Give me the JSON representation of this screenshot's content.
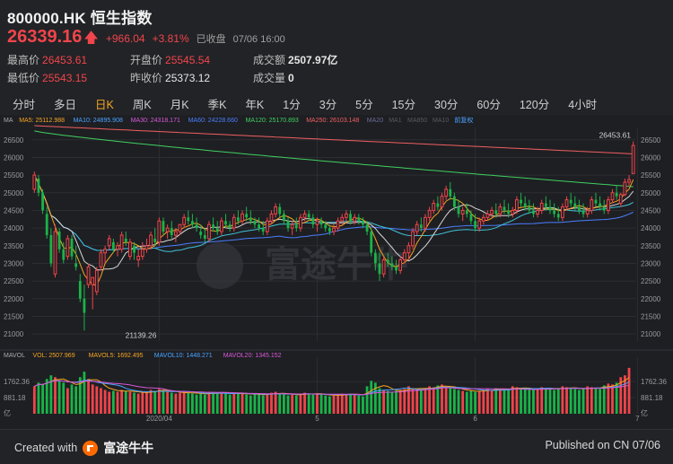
{
  "header": {
    "title": "800000.HK 恒生指数",
    "price": "26339.16",
    "change": "+966.04",
    "change_pct": "+3.81%",
    "status": "已收盘",
    "datetime": "07/06 16:00"
  },
  "stats": [
    {
      "label": "最高价",
      "value": "26453.61",
      "tone": "up"
    },
    {
      "label": "开盘价",
      "value": "25545.54",
      "tone": "up"
    },
    {
      "label": "成交额",
      "value": "2507.97亿",
      "tone": "neutral"
    },
    {
      "label": "最低价",
      "value": "25543.15",
      "tone": "up"
    },
    {
      "label": "昨收价",
      "value": "25373.12",
      "tone": "neutral"
    },
    {
      "label": "成交量",
      "value": "0",
      "tone": "neutral"
    }
  ],
  "tabs": [
    "分时",
    "多日",
    "日K",
    "周K",
    "月K",
    "季K",
    "年K",
    "1分",
    "3分",
    "5分",
    "15分",
    "30分",
    "60分",
    "120分",
    "4小时"
  ],
  "active_tab": "日K",
  "ma_legend": [
    {
      "label": "MA",
      "color": "#aaaaaa"
    },
    {
      "label": "MA5: 25112.988",
      "color": "#f5a623"
    },
    {
      "label": "MA10: 24895.908",
      "color": "#4aa3ff"
    },
    {
      "label": "MA30: 24318.171",
      "color": "#d858d8"
    },
    {
      "label": "MA60: 24228.660",
      "color": "#4a7fff"
    },
    {
      "label": "MA120: 25170.893",
      "color": "#40d060"
    },
    {
      "label": "MA250: 26103.148",
      "color": "#f06060"
    },
    {
      "label": "MA20",
      "color": "#6b6b9a"
    },
    {
      "label": "MA1",
      "color": "#5a5a5a"
    },
    {
      "label": "MA850",
      "color": "#5a5a5a"
    },
    {
      "label": "MA10",
      "color": "#5a5a5a"
    },
    {
      "label": "前复权",
      "color": "#4aa3ff"
    }
  ],
  "vol_legend": [
    {
      "label": "MAVOL",
      "color": "#aaaaaa"
    },
    {
      "label": "VOL: 2507.969",
      "color": "#f5a623"
    },
    {
      "label": "MAVOL5: 1692.495",
      "color": "#f5a623"
    },
    {
      "label": "MAVOL10: 1448.271",
      "color": "#4aa3ff"
    },
    {
      "label": "MAVOL20: 1345.152",
      "color": "#d858d8"
    }
  ],
  "watermark": "富途牛牛",
  "footer": {
    "created_with": "Created with",
    "brand": "富途牛牛",
    "published": "Published on CN 07/06"
  },
  "colors": {
    "up": "#f0454a",
    "down": "#19b548",
    "accent": "#f5a623",
    "background": "#222327"
  },
  "chart_data": {
    "type": "candlestick",
    "y_axis": {
      "ticks": [
        21000,
        21500,
        22000,
        22500,
        23000,
        23500,
        24000,
        24500,
        25000,
        25500,
        26000,
        26500
      ],
      "ylim": [
        20800,
        26850
      ]
    },
    "x_labels": [
      {
        "index": 30,
        "label": "2020/04"
      },
      {
        "index": 68,
        "label": "5"
      },
      {
        "index": 106,
        "label": "6"
      },
      {
        "index": 145,
        "label": "7"
      }
    ],
    "annotations": [
      {
        "label": "26453.61",
        "index": 147,
        "value": 26453.61
      },
      {
        "label": "21139.26",
        "index": 21,
        "value": 21139.26
      }
    ],
    "volume_axis": {
      "ticks": [
        "1762.36",
        "881.18",
        "亿"
      ],
      "ymax": 2600
    },
    "candles": [
      {
        "o": 25100,
        "h": 25600,
        "l": 25000,
        "c": 25500
      },
      {
        "o": 25400,
        "h": 25500,
        "l": 24900,
        "c": 25000
      },
      {
        "o": 25000,
        "h": 25100,
        "l": 24400,
        "c": 24500
      },
      {
        "o": 24400,
        "h": 24600,
        "l": 23700,
        "c": 23800
      },
      {
        "o": 23800,
        "h": 24000,
        "l": 22900,
        "c": 23000
      },
      {
        "o": 22700,
        "h": 24100,
        "l": 22600,
        "c": 23900
      },
      {
        "o": 23900,
        "h": 24000,
        "l": 23300,
        "c": 23400
      },
      {
        "o": 23400,
        "h": 23600,
        "l": 23000,
        "c": 23100
      },
      {
        "o": 23200,
        "h": 23800,
        "l": 23100,
        "c": 23700
      },
      {
        "o": 23700,
        "h": 23800,
        "l": 23100,
        "c": 23200
      },
      {
        "o": 23000,
        "h": 23500,
        "l": 22800,
        "c": 22900
      },
      {
        "o": 22500,
        "h": 22700,
        "l": 21900,
        "c": 22000
      },
      {
        "o": 22000,
        "h": 22400,
        "l": 21100,
        "c": 21600
      },
      {
        "o": 22400,
        "h": 23000,
        "l": 22300,
        "c": 22900
      },
      {
        "o": 22400,
        "h": 22500,
        "l": 21700,
        "c": 22600
      },
      {
        "o": 22200,
        "h": 22900,
        "l": 22100,
        "c": 22800
      },
      {
        "o": 22900,
        "h": 23400,
        "l": 22800,
        "c": 23300
      },
      {
        "o": 23300,
        "h": 23500,
        "l": 23000,
        "c": 23400
      },
      {
        "o": 23500,
        "h": 23800,
        "l": 23400,
        "c": 23700
      },
      {
        "o": 23600,
        "h": 23700,
        "l": 23300,
        "c": 23400
      },
      {
        "o": 23400,
        "h": 23600,
        "l": 23200,
        "c": 23500
      },
      {
        "o": 23400,
        "h": 23900,
        "l": 23300,
        "c": 23800
      },
      {
        "o": 23700,
        "h": 23900,
        "l": 23500,
        "c": 23600
      },
      {
        "o": 23200,
        "h": 23700,
        "l": 23100,
        "c": 23600
      },
      {
        "o": 23500,
        "h": 23600,
        "l": 23100,
        "c": 23300
      },
      {
        "o": 23100,
        "h": 23400,
        "l": 22900,
        "c": 23200
      },
      {
        "o": 23200,
        "h": 23600,
        "l": 23100,
        "c": 23400
      },
      {
        "o": 23400,
        "h": 23700,
        "l": 23300,
        "c": 23500
      },
      {
        "o": 23500,
        "h": 23900,
        "l": 23400,
        "c": 23800
      },
      {
        "o": 23700,
        "h": 24000,
        "l": 23500,
        "c": 23600
      },
      {
        "o": 23600,
        "h": 24300,
        "l": 23500,
        "c": 24200
      },
      {
        "o": 24200,
        "h": 24300,
        "l": 23800,
        "c": 23900
      },
      {
        "o": 23900,
        "h": 24100,
        "l": 23700,
        "c": 24000
      },
      {
        "o": 24000,
        "h": 24200,
        "l": 23700,
        "c": 23800
      },
      {
        "o": 23800,
        "h": 24000,
        "l": 23600,
        "c": 23900
      },
      {
        "o": 23900,
        "h": 24100,
        "l": 23800,
        "c": 24100
      },
      {
        "o": 24100,
        "h": 24400,
        "l": 24000,
        "c": 24300
      },
      {
        "o": 24300,
        "h": 24500,
        "l": 24100,
        "c": 24200
      },
      {
        "o": 24200,
        "h": 24400,
        "l": 24000,
        "c": 24100
      },
      {
        "o": 24100,
        "h": 24300,
        "l": 23900,
        "c": 24000
      },
      {
        "o": 23900,
        "h": 24100,
        "l": 23700,
        "c": 23800
      },
      {
        "o": 23800,
        "h": 24000,
        "l": 23600,
        "c": 23700
      },
      {
        "o": 23700,
        "h": 24200,
        "l": 23600,
        "c": 24100
      },
      {
        "o": 24100,
        "h": 24300,
        "l": 23900,
        "c": 24000
      },
      {
        "o": 24000,
        "h": 24200,
        "l": 23800,
        "c": 23900
      },
      {
        "o": 23900,
        "h": 24300,
        "l": 23800,
        "c": 24200
      },
      {
        "o": 24200,
        "h": 24400,
        "l": 24000,
        "c": 24100
      },
      {
        "o": 24100,
        "h": 24200,
        "l": 23900,
        "c": 24000
      },
      {
        "o": 24000,
        "h": 24400,
        "l": 23900,
        "c": 24300
      },
      {
        "o": 24300,
        "h": 24500,
        "l": 24100,
        "c": 24200
      },
      {
        "o": 24200,
        "h": 24500,
        "l": 24100,
        "c": 24400
      },
      {
        "o": 24400,
        "h": 24600,
        "l": 24200,
        "c": 24300
      },
      {
        "o": 24300,
        "h": 24500,
        "l": 24100,
        "c": 24200
      },
      {
        "o": 24200,
        "h": 24300,
        "l": 24000,
        "c": 24100
      },
      {
        "o": 24100,
        "h": 24300,
        "l": 23900,
        "c": 24000
      },
      {
        "o": 24000,
        "h": 24200,
        "l": 23800,
        "c": 23900
      },
      {
        "o": 23900,
        "h": 24300,
        "l": 23800,
        "c": 24200
      },
      {
        "o": 24200,
        "h": 24500,
        "l": 24100,
        "c": 24400
      },
      {
        "o": 24400,
        "h": 24700,
        "l": 24300,
        "c": 24600
      },
      {
        "o": 24600,
        "h": 24700,
        "l": 24300,
        "c": 24400
      },
      {
        "o": 24400,
        "h": 24500,
        "l": 24100,
        "c": 24200
      },
      {
        "o": 24200,
        "h": 24300,
        "l": 23900,
        "c": 24000
      },
      {
        "o": 24000,
        "h": 24200,
        "l": 23800,
        "c": 24100
      },
      {
        "o": 24100,
        "h": 24300,
        "l": 23900,
        "c": 24000
      },
      {
        "o": 24000,
        "h": 24400,
        "l": 23900,
        "c": 24300
      },
      {
        "o": 24300,
        "h": 24500,
        "l": 24200,
        "c": 24400
      },
      {
        "o": 24400,
        "h": 24500,
        "l": 24200,
        "c": 24300
      },
      {
        "o": 24300,
        "h": 24400,
        "l": 24000,
        "c": 24100
      },
      {
        "o": 24100,
        "h": 24300,
        "l": 23900,
        "c": 24200
      },
      {
        "o": 24200,
        "h": 24300,
        "l": 24000,
        "c": 24100
      },
      {
        "o": 24100,
        "h": 24200,
        "l": 23900,
        "c": 24000
      },
      {
        "o": 24000,
        "h": 24100,
        "l": 23800,
        "c": 23900
      },
      {
        "o": 23900,
        "h": 24100,
        "l": 23800,
        "c": 24000
      },
      {
        "o": 24000,
        "h": 24300,
        "l": 23900,
        "c": 24200
      },
      {
        "o": 24200,
        "h": 24400,
        "l": 24100,
        "c": 24300
      },
      {
        "o": 24300,
        "h": 24500,
        "l": 24200,
        "c": 24400
      },
      {
        "o": 24400,
        "h": 24500,
        "l": 24100,
        "c": 24200
      },
      {
        "o": 24200,
        "h": 24400,
        "l": 24100,
        "c": 24300
      },
      {
        "o": 24300,
        "h": 24400,
        "l": 24100,
        "c": 24200
      },
      {
        "o": 24200,
        "h": 24300,
        "l": 24000,
        "c": 24100
      },
      {
        "o": 24100,
        "h": 24200,
        "l": 23800,
        "c": 23900
      },
      {
        "o": 23900,
        "h": 24000,
        "l": 23200,
        "c": 23300
      },
      {
        "o": 23300,
        "h": 23400,
        "l": 22800,
        "c": 23000
      },
      {
        "o": 23000,
        "h": 23300,
        "l": 22500,
        "c": 22700
      },
      {
        "o": 22700,
        "h": 23200,
        "l": 22600,
        "c": 23100
      },
      {
        "o": 23100,
        "h": 23300,
        "l": 22900,
        "c": 23000
      },
      {
        "o": 23000,
        "h": 23200,
        "l": 22800,
        "c": 22900
      },
      {
        "o": 22900,
        "h": 23100,
        "l": 22700,
        "c": 22800
      },
      {
        "o": 22800,
        "h": 23200,
        "l": 22700,
        "c": 23100
      },
      {
        "o": 23100,
        "h": 23400,
        "l": 23000,
        "c": 23300
      },
      {
        "o": 23300,
        "h": 23600,
        "l": 23100,
        "c": 23500
      },
      {
        "o": 23500,
        "h": 24000,
        "l": 23400,
        "c": 23900
      },
      {
        "o": 23900,
        "h": 24200,
        "l": 23800,
        "c": 24100
      },
      {
        "o": 24100,
        "h": 24300,
        "l": 23900,
        "c": 24000
      },
      {
        "o": 24000,
        "h": 24400,
        "l": 23900,
        "c": 24300
      },
      {
        "o": 24300,
        "h": 24600,
        "l": 24200,
        "c": 24500
      },
      {
        "o": 24500,
        "h": 24800,
        "l": 24400,
        "c": 24700
      },
      {
        "o": 24700,
        "h": 24900,
        "l": 24500,
        "c": 24600
      },
      {
        "o": 24600,
        "h": 25000,
        "l": 24500,
        "c": 24900
      },
      {
        "o": 24900,
        "h": 25200,
        "l": 24800,
        "c": 25100
      },
      {
        "o": 25100,
        "h": 25300,
        "l": 24800,
        "c": 24900
      },
      {
        "o": 24900,
        "h": 25000,
        "l": 24500,
        "c": 24600
      },
      {
        "o": 24600,
        "h": 24800,
        "l": 24300,
        "c": 24400
      },
      {
        "o": 24400,
        "h": 24600,
        "l": 24200,
        "c": 24500
      },
      {
        "o": 24500,
        "h": 24700,
        "l": 24300,
        "c": 24400
      },
      {
        "o": 24400,
        "h": 24500,
        "l": 24100,
        "c": 24200
      },
      {
        "o": 24200,
        "h": 24400,
        "l": 23900,
        "c": 24000
      },
      {
        "o": 24000,
        "h": 24300,
        "l": 23900,
        "c": 24200
      },
      {
        "o": 24200,
        "h": 24400,
        "l": 24100,
        "c": 24300
      },
      {
        "o": 24300,
        "h": 24500,
        "l": 24200,
        "c": 24400
      },
      {
        "o": 24400,
        "h": 24600,
        "l": 24300,
        "c": 24500
      },
      {
        "o": 24500,
        "h": 24700,
        "l": 24300,
        "c": 24400
      },
      {
        "o": 24400,
        "h": 24700,
        "l": 24300,
        "c": 24600
      },
      {
        "o": 24600,
        "h": 24800,
        "l": 24400,
        "c": 24500
      },
      {
        "o": 24500,
        "h": 24700,
        "l": 24300,
        "c": 24400
      },
      {
        "o": 24400,
        "h": 24600,
        "l": 24300,
        "c": 24500
      },
      {
        "o": 24500,
        "h": 24900,
        "l": 24400,
        "c": 24800
      },
      {
        "o": 24800,
        "h": 25000,
        "l": 24600,
        "c": 24700
      },
      {
        "o": 24700,
        "h": 24900,
        "l": 24500,
        "c": 24600
      },
      {
        "o": 24600,
        "h": 24800,
        "l": 24400,
        "c": 24500
      },
      {
        "o": 24500,
        "h": 24700,
        "l": 24300,
        "c": 24400
      },
      {
        "o": 24400,
        "h": 24600,
        "l": 24300,
        "c": 24500
      },
      {
        "o": 24500,
        "h": 24800,
        "l": 24400,
        "c": 24700
      },
      {
        "o": 24700,
        "h": 24900,
        "l": 24500,
        "c": 24600
      },
      {
        "o": 24600,
        "h": 24800,
        "l": 24400,
        "c": 24500
      },
      {
        "o": 24500,
        "h": 24700,
        "l": 24300,
        "c": 24400
      },
      {
        "o": 24400,
        "h": 24600,
        "l": 24200,
        "c": 24300
      },
      {
        "o": 24300,
        "h": 24700,
        "l": 24200,
        "c": 24600
      },
      {
        "o": 24600,
        "h": 24900,
        "l": 24500,
        "c": 24800
      },
      {
        "o": 24800,
        "h": 25000,
        "l": 24600,
        "c": 24700
      },
      {
        "o": 24700,
        "h": 24900,
        "l": 24500,
        "c": 24600
      },
      {
        "o": 24600,
        "h": 24800,
        "l": 24400,
        "c": 24500
      },
      {
        "o": 24500,
        "h": 24700,
        "l": 24300,
        "c": 24400
      },
      {
        "o": 24400,
        "h": 24600,
        "l": 24300,
        "c": 24500
      },
      {
        "o": 24500,
        "h": 24900,
        "l": 24400,
        "c": 24800
      },
      {
        "o": 24800,
        "h": 25000,
        "l": 24600,
        "c": 24700
      },
      {
        "o": 24700,
        "h": 24900,
        "l": 24500,
        "c": 24600
      },
      {
        "o": 24600,
        "h": 24800,
        "l": 24400,
        "c": 24500
      },
      {
        "o": 24500,
        "h": 24900,
        "l": 24400,
        "c": 24800
      },
      {
        "o": 24800,
        "h": 25100,
        "l": 24700,
        "c": 25000
      },
      {
        "o": 25000,
        "h": 25200,
        "l": 24800,
        "c": 24900
      },
      {
        "o": 24700,
        "h": 25000,
        "l": 24600,
        "c": 24950
      },
      {
        "o": 24950,
        "h": 25400,
        "l": 24900,
        "c": 25300
      },
      {
        "o": 25300,
        "h": 25500,
        "l": 25200,
        "c": 25373
      },
      {
        "o": 25545,
        "h": 26453,
        "l": 25543,
        "c": 26339
      }
    ],
    "volumes": [
      1500,
      1700,
      1600,
      1900,
      2100,
      2000,
      1800,
      1700,
      1400,
      1600,
      1500,
      2000,
      2300,
      1900,
      1600,
      1500,
      1400,
      1300,
      1200,
      1250,
      1200,
      1300,
      1250,
      1200,
      1150,
      1100,
      1150,
      1200,
      1300,
      1250,
      1350,
      1300,
      1200,
      1150,
      1100,
      1150,
      1200,
      1150,
      1100,
      1050,
      1100,
      1050,
      1200,
      1150,
      1100,
      1150,
      1100,
      1050,
      1100,
      1150,
      1100,
      1050,
      1000,
      1100,
      1050,
      1000,
      1100,
      1150,
      1200,
      1100,
      1050,
      1000,
      1050,
      1000,
      1100,
      1150,
      1100,
      1050,
      1100,
      1050,
      1000,
      950,
      1000,
      1050,
      1100,
      1050,
      1100,
      1050,
      1000,
      950,
      1500,
      1800,
      1700,
      1400,
      1300,
      1250,
      1200,
      1250,
      1300,
      1350,
      1500,
      1400,
      1300,
      1350,
      1400,
      1500,
      1450,
      1550,
      1600,
      1450,
      1400,
      1350,
      1300,
      1250,
      1200,
      1250,
      1200,
      1250,
      1300,
      1350,
      1300,
      1400,
      1350,
      1300,
      1350,
      1500,
      1450,
      1400,
      1350,
      1300,
      1350,
      1400,
      1450,
      1400,
      1350,
      1300,
      1400,
      1500,
      1450,
      1400,
      1350,
      1300,
      1350,
      1500,
      1450,
      1400,
      1350,
      1550,
      1650,
      1600,
      1700,
      2000,
      2100,
      2508
    ]
  }
}
